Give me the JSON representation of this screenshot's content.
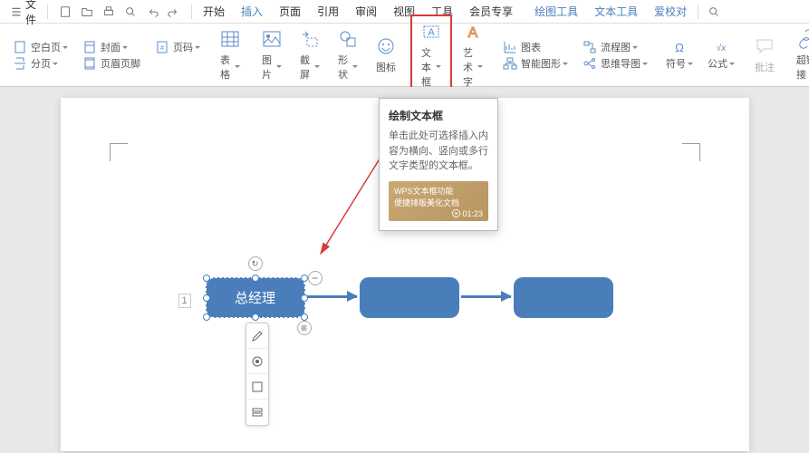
{
  "menubar": {
    "file": "文件",
    "tabs": [
      "开始",
      "插入",
      "页面",
      "引用",
      "审阅",
      "视图",
      "工具",
      "会员专享"
    ],
    "active_tab_index": 1,
    "context_tabs": [
      "绘图工具",
      "文本工具",
      "爱校对"
    ]
  },
  "ribbon": {
    "blank_page": "空白页",
    "cover": "封面",
    "page_num": "页码",
    "page_break": "分页",
    "header_footer": "页眉页脚",
    "table": "表格",
    "picture": "图片",
    "screenshot": "截屏",
    "shapes": "形状",
    "icons": "图标",
    "textbox": "文本框",
    "wordart": "艺术字",
    "chart": "图表",
    "smartart": "智能图形",
    "flowchart": "流程图",
    "mindmap": "思维导图",
    "symbol": "符号",
    "equation": "公式",
    "comment": "批注",
    "hyperlink": "超链接"
  },
  "tooltip": {
    "title": "绘制文本框",
    "body": "单击此处可选择插入内容为横向、竖向或多行文字类型的文本框。",
    "video_line1": "WPS文本框功能",
    "video_line2": "便捷排版美化文档",
    "duration": "01:23"
  },
  "canvas": {
    "shape1_text": "总经理",
    "page_indicator": "1"
  }
}
